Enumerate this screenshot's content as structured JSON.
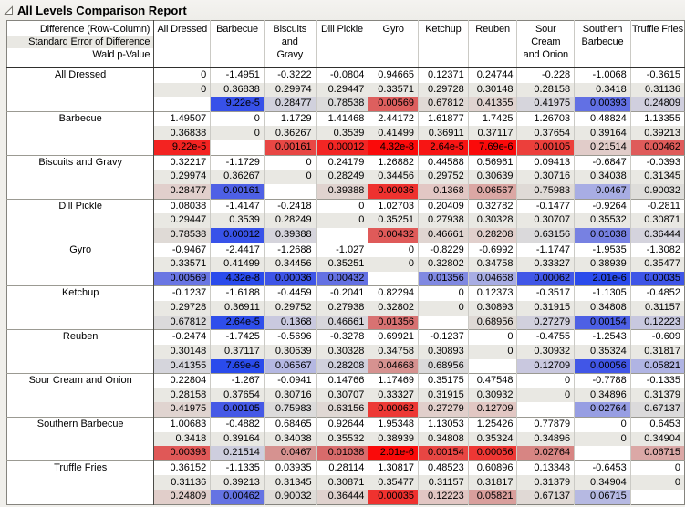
{
  "title": "All Levels Comparison Report",
  "header": {
    "row1": "Difference (Row-Column)",
    "row2": "Standard Error of Difference",
    "row3": "Wald p-Value",
    "column_lines": [
      [
        "All Dressed"
      ],
      [
        "Barbecue"
      ],
      [
        "Biscuits",
        "and",
        "Gravy"
      ],
      [
        "Dill Pickle"
      ],
      [
        "Gyro"
      ],
      [
        "Ketchup"
      ],
      [
        "Reuben"
      ],
      [
        "Sour",
        "Cream",
        "and Onion"
      ],
      [
        "Southern",
        "Barbecue"
      ],
      [
        "Truffle Fries"
      ]
    ]
  },
  "levels": [
    "All Dressed",
    "Barbecue",
    "Biscuits and Gravy",
    "Dill Pickle",
    "Gyro",
    "Ketchup",
    "Reuben",
    "Sour Cream and Onion",
    "Southern Barbecue",
    "Truffle Fries"
  ],
  "matrix": {
    "difference": [
      [
        "0",
        "-1.4951",
        "-0.3222",
        "-0.0804",
        "0.94665",
        "0.12371",
        "0.24744",
        "-0.228",
        "-1.0068",
        "-0.3615"
      ],
      [
        "1.49507",
        "0",
        "1.1729",
        "1.41468",
        "2.44172",
        "1.61877",
        "1.7425",
        "1.26703",
        "0.48824",
        "1.13355"
      ],
      [
        "0.32217",
        "-1.1729",
        "0",
        "0.24179",
        "1.26882",
        "0.44588",
        "0.56961",
        "0.09413",
        "-0.6847",
        "-0.0393"
      ],
      [
        "0.08038",
        "-1.4147",
        "-0.2418",
        "0",
        "1.02703",
        "0.20409",
        "0.32782",
        "-0.1477",
        "-0.9264",
        "-0.2811"
      ],
      [
        "-0.9467",
        "-2.4417",
        "-1.2688",
        "-1.027",
        "0",
        "-0.8229",
        "-0.6992",
        "-1.1747",
        "-1.9535",
        "-1.3082"
      ],
      [
        "-0.1237",
        "-1.6188",
        "-0.4459",
        "-0.2041",
        "0.82294",
        "0",
        "0.12373",
        "-0.3517",
        "-1.1305",
        "-0.4852"
      ],
      [
        "-0.2474",
        "-1.7425",
        "-0.5696",
        "-0.3278",
        "0.69921",
        "-0.1237",
        "0",
        "-0.4755",
        "-1.2543",
        "-0.609"
      ],
      [
        "0.22804",
        "-1.267",
        "-0.0941",
        "0.14766",
        "1.17469",
        "0.35175",
        "0.47548",
        "0",
        "-0.7788",
        "-0.1335"
      ],
      [
        "1.00683",
        "-0.4882",
        "0.68465",
        "0.92644",
        "1.95348",
        "1.13053",
        "1.25426",
        "0.77879",
        "0",
        "0.6453"
      ],
      [
        "0.36152",
        "-1.1335",
        "0.03935",
        "0.28114",
        "1.30817",
        "0.48523",
        "0.60896",
        "0.13348",
        "-0.6453",
        "0"
      ]
    ],
    "std_error": [
      [
        "0",
        "0.36838",
        "0.29974",
        "0.29447",
        "0.33571",
        "0.29728",
        "0.30148",
        "0.28158",
        "0.3418",
        "0.31136"
      ],
      [
        "0.36838",
        "0",
        "0.36267",
        "0.3539",
        "0.41499",
        "0.36911",
        "0.37117",
        "0.37654",
        "0.39164",
        "0.39213"
      ],
      [
        "0.29974",
        "0.36267",
        "0",
        "0.28249",
        "0.34456",
        "0.29752",
        "0.30639",
        "0.30716",
        "0.34038",
        "0.31345"
      ],
      [
        "0.29447",
        "0.3539",
        "0.28249",
        "0",
        "0.35251",
        "0.27938",
        "0.30328",
        "0.30707",
        "0.35532",
        "0.30871"
      ],
      [
        "0.33571",
        "0.41499",
        "0.34456",
        "0.35251",
        "0",
        "0.32802",
        "0.34758",
        "0.33327",
        "0.38939",
        "0.35477"
      ],
      [
        "0.29728",
        "0.36911",
        "0.29752",
        "0.27938",
        "0.32802",
        "0",
        "0.30893",
        "0.31915",
        "0.34808",
        "0.31157"
      ],
      [
        "0.30148",
        "0.37117",
        "0.30639",
        "0.30328",
        "0.34758",
        "0.30893",
        "0",
        "0.30932",
        "0.35324",
        "0.31817"
      ],
      [
        "0.28158",
        "0.37654",
        "0.30716",
        "0.30707",
        "0.33327",
        "0.31915",
        "0.30932",
        "0",
        "0.34896",
        "0.31379"
      ],
      [
        "0.3418",
        "0.39164",
        "0.34038",
        "0.35532",
        "0.38939",
        "0.34808",
        "0.35324",
        "0.34896",
        "0",
        "0.34904"
      ],
      [
        "0.31136",
        "0.39213",
        "0.31345",
        "0.30871",
        "0.35477",
        "0.31157",
        "0.31817",
        "0.31379",
        "0.34904",
        "0"
      ]
    ],
    "wald_p": [
      [
        "",
        "9.22e-5",
        "0.28477",
        "0.78538",
        "0.00569",
        "0.67812",
        "0.41355",
        "0.41975",
        "0.00393",
        "0.24809"
      ],
      [
        "9.22e-5",
        "",
        "0.00161",
        "0.00012",
        "4.32e-8",
        "2.64e-5",
        "7.69e-6",
        "0.00105",
        "0.21514",
        "0.00462"
      ],
      [
        "0.28477",
        "0.00161",
        "",
        "0.39388",
        "0.00036",
        "0.1368",
        "0.06567",
        "0.75983",
        "0.0467",
        "0.90032"
      ],
      [
        "0.78538",
        "0.00012",
        "0.39388",
        "",
        "0.00432",
        "0.46661",
        "0.28208",
        "0.63156",
        "0.01038",
        "0.36444"
      ],
      [
        "0.00569",
        "4.32e-8",
        "0.00036",
        "0.00432",
        "",
        "0.01356",
        "0.04668",
        "0.00062",
        "2.01e-6",
        "0.00035"
      ],
      [
        "0.67812",
        "2.64e-5",
        "0.1368",
        "0.46661",
        "0.01356",
        "",
        "0.68956",
        "0.27279",
        "0.00154",
        "0.12223"
      ],
      [
        "0.41355",
        "7.69e-6",
        "0.06567",
        "0.28208",
        "0.04668",
        "0.68956",
        "",
        "0.12709",
        "0.00056",
        "0.05821"
      ],
      [
        "0.41975",
        "0.00105",
        "0.75983",
        "0.63156",
        "0.00062",
        "0.27279",
        "0.12709",
        "",
        "0.02764",
        "0.67137"
      ],
      [
        "0.00393",
        "0.21514",
        "0.0467",
        "0.01038",
        "2.01e-6",
        "0.00154",
        "0.00056",
        "0.02764",
        "",
        "0.06715"
      ],
      [
        "0.24809",
        "0.00462",
        "0.90032",
        "0.36444",
        "0.00035",
        "0.12223",
        "0.05821",
        "0.67137",
        "0.06715",
        ""
      ]
    ]
  },
  "colors": {
    "significant_positive_red": "#FA0A0A",
    "significant_negative_blue": "#2A4BEC",
    "se_row_background": "#E9E8E3",
    "p_value_scale": {
      "note": "background of Wald p-Value cells: hue from sign of difference, intensity from -log10(p)",
      "red_stops": {
        "0": "#DFDDD9",
        "1": "#E2C4C1",
        "1.301": "#D69492",
        "2": "#D86A6A",
        "3": "#EC3E3A",
        "5": "#FA0A0A"
      },
      "blue_stops": {
        "0": "#DFDEDA",
        "1": "#C6C6E0",
        "1.301": "#AAAFE4",
        "2": "#7680E2",
        "3": "#4458E6",
        "5": "#2A4BEC"
      }
    }
  }
}
